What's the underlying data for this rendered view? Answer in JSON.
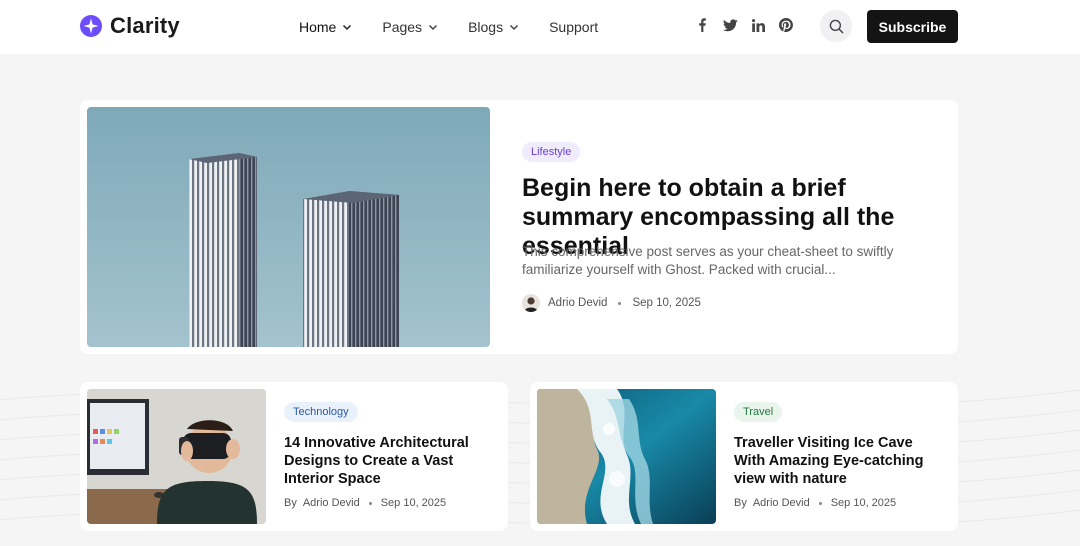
{
  "brand": {
    "name": "Clarity",
    "accent": "#6d4dfa"
  },
  "nav": {
    "items": [
      {
        "label": "Home",
        "dropdown": true,
        "active": true
      },
      {
        "label": "Pages",
        "dropdown": true,
        "active": false
      },
      {
        "label": "Blogs",
        "dropdown": true,
        "active": false
      },
      {
        "label": "Support",
        "dropdown": false,
        "active": false
      }
    ]
  },
  "social": [
    "facebook-icon",
    "twitter-icon",
    "linkedin-icon",
    "pinterest-icon"
  ],
  "header": {
    "subscribe_label": "Subscribe"
  },
  "hero": {
    "tag": "Lifestyle",
    "title": "Begin here to obtain a brief summary encompassing all the essential",
    "excerpt": "This comprehensive post serves as your cheat-sheet to swiftly familiarize yourself with Ghost. Packed with crucial...",
    "author": "Adrio Devid",
    "date": "Sep 10, 2025"
  },
  "posts": [
    {
      "tag": "Technology",
      "title": "14 Innovative Architectural Designs to Create a Vast Interior Space",
      "by": "By",
      "author": "Adrio Devid",
      "date": "Sep 10, 2025"
    },
    {
      "tag": "Travel",
      "title": "Traveller Visiting Ice Cave With Amazing Eye-catching view with nature",
      "by": "By",
      "author": "Adrio Devid",
      "date": "Sep 10, 2025"
    }
  ]
}
